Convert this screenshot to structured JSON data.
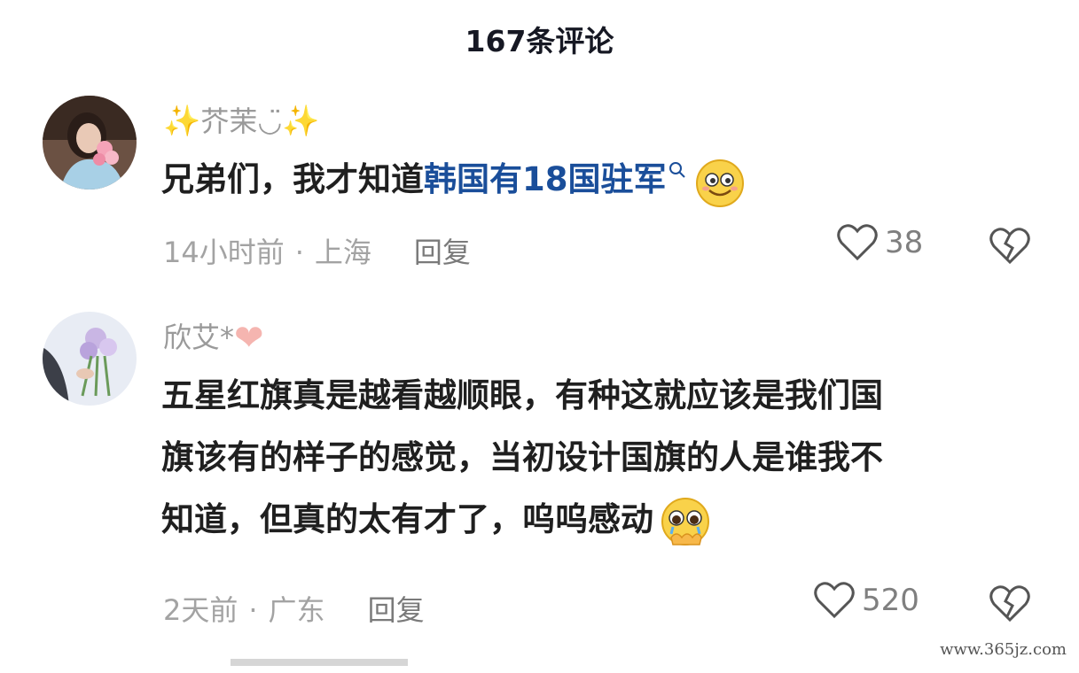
{
  "header": {
    "title": "167条评论"
  },
  "comments": [
    {
      "user": {
        "name": "芥茉◡̈",
        "prefix": "✨",
        "suffix": "✨"
      },
      "text": {
        "plain": "兄弟们，我才知道",
        "link": "韩国有18国驻军"
      },
      "emoji": "smiling-face-emoji",
      "meta": {
        "time": "14小时前",
        "sep": "·",
        "location": "上海",
        "reply": "回复"
      },
      "likes": "38"
    },
    {
      "user": {
        "name": "欣艾*",
        "suffix": "❤"
      },
      "text": {
        "line1": "五星红旗真是越看越顺眼，有种这就应该是我们国",
        "line2": "旗该有的样子的感觉，当初设计国旗的人是谁我不",
        "line3": "知道，但真的太有才了，呜呜感动"
      },
      "emoji": "holding-back-tears-emoji",
      "meta": {
        "time": "2天前",
        "sep": "·",
        "location": "广东",
        "reply": "回复"
      },
      "likes": "520"
    }
  ],
  "watermark": "www.365jz.com",
  "colors": {
    "link": "#1a4e9a",
    "meta": "#a3a3a3",
    "text": "#1f1f1f"
  }
}
